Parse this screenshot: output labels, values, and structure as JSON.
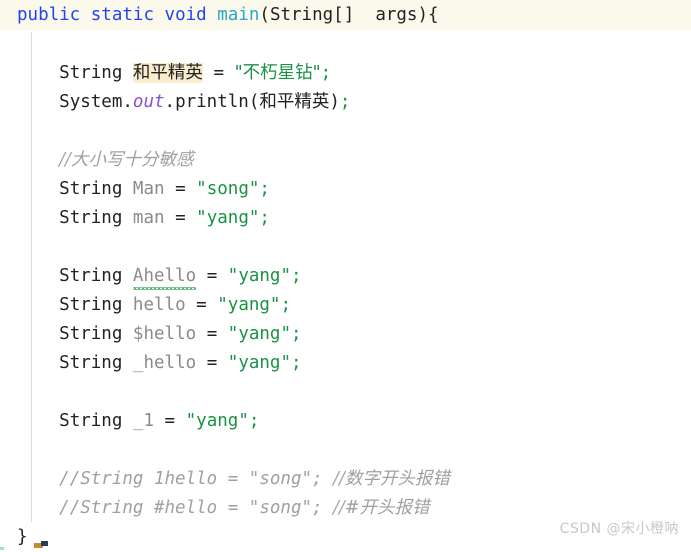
{
  "editor": {
    "language": "java",
    "background_color": "#ffffff",
    "first_line_highlight_color": "#fbf9ec",
    "variable_highlight_color": "#faeccc",
    "indent_guide_color": "#dcdcdc",
    "colors": {
      "keyword": "#2244ee",
      "method": "#2aa6c8",
      "string": "#1a9245",
      "comment": "#a0a0a0",
      "identifier": "#8a8a8a",
      "static_field": "#8a52c9",
      "text": "#222222",
      "error_squiggle": "#33a852",
      "caret_mark": "#8fd4d8"
    }
  },
  "code": {
    "line1": {
      "kw_public": "public",
      "sp1": " ",
      "kw_static": "static",
      "sp2": " ",
      "kw_void": "void",
      "sp3": " ",
      "method_main": "main",
      "paren_open": "(",
      "type_string_array": "String[]",
      "sp4": "  ",
      "param_args": "args",
      "paren_close": ")",
      "brace_open": "{"
    },
    "line3": {
      "type": "String",
      "sp1": " ",
      "var_highlighted": "和平精英",
      "sp2": " ",
      "equals": "=",
      "sp3": " ",
      "string_value": "\"不朽星钻\"",
      "semicolon": ";"
    },
    "line4": {
      "system": "System.",
      "field_out": "out",
      "dot_println": ".println",
      "paren_open": "(",
      "arg": "和平精英",
      "paren_close": ")",
      "semicolon": ";"
    },
    "line6_comment": "//大小写十分敏感",
    "line7": {
      "type": "String",
      "sp1": " ",
      "var": "Man",
      "sp2": " ",
      "equals": "=",
      "sp3": " ",
      "string_value": "\"song\"",
      "semicolon": ";"
    },
    "line8": {
      "type": "String",
      "sp1": " ",
      "var": "man",
      "sp2": " ",
      "equals": "=",
      "sp3": " ",
      "string_value": "\"yang\"",
      "semicolon": ";"
    },
    "line10": {
      "type": "String",
      "sp1": " ",
      "var": "Ahello",
      "sp2": " ",
      "equals": "=",
      "sp3": " ",
      "string_value": "\"yang\"",
      "semicolon": ";",
      "has_squiggle": true
    },
    "line11": {
      "type": "String",
      "sp1": " ",
      "var": "hello",
      "sp2": " ",
      "equals": "=",
      "sp3": " ",
      "string_value": "\"yang\"",
      "semicolon": ";"
    },
    "line12": {
      "type": "String",
      "sp1": " ",
      "var": "$hello",
      "sp2": " ",
      "equals": "=",
      "sp3": " ",
      "string_value": "\"yang\"",
      "semicolon": ";"
    },
    "line13": {
      "type": "String",
      "sp1": " ",
      "var": "_hello",
      "sp2": " ",
      "equals": "=",
      "sp3": " ",
      "string_value": "\"yang\"",
      "semicolon": ";"
    },
    "line15": {
      "type": "String",
      "sp1": " ",
      "var": "_1",
      "sp2": " ",
      "equals": "=",
      "sp3": " ",
      "string_value": "\"yang\"",
      "semicolon": ";"
    },
    "line17_comment_code": "//String 1hello = \"song\"; ",
    "line17_comment_note": "//数字开头报错",
    "line18_comment_code": "//String #hello = \"song\"; ",
    "line18_comment_note": "//#开头报错",
    "line19_brace_close": "}"
  },
  "watermark": {
    "text": "CSDN @宋小橙呐"
  }
}
